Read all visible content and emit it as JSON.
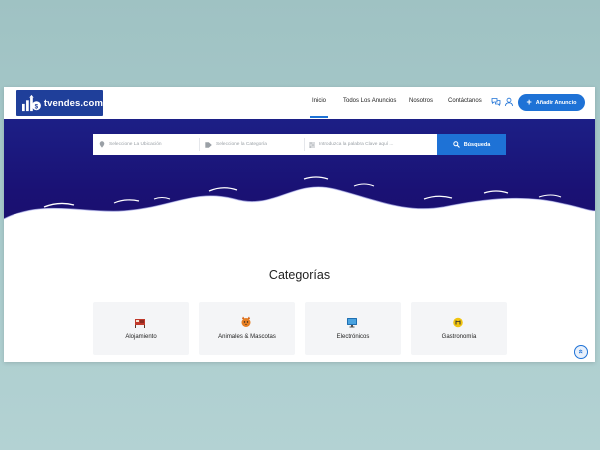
{
  "header": {
    "logo_text": "tvendes.com",
    "nav": [
      {
        "label": "Inicio",
        "active": true
      },
      {
        "label": "Todos Los Anuncios",
        "active": false
      },
      {
        "label": "Nosotros",
        "active": false
      },
      {
        "label": "Contáctanos",
        "active": false
      }
    ],
    "icons": [
      "chat-icon",
      "user-icon"
    ],
    "cta_label": "Añadir Anuncio"
  },
  "search": {
    "location_placeholder": "Seleccione La Ubicación",
    "category_placeholder": "Seleccione la Categoría",
    "keyword_placeholder": "Introduzca la palabra Clave aquí ...",
    "button_label": "Búsqueda"
  },
  "categories": {
    "title": "Categorías",
    "items": [
      {
        "label": "Alojamiento",
        "icon": "lodging-icon"
      },
      {
        "label": "Animales & Mascotas",
        "icon": "pets-icon"
      },
      {
        "label": "Electrónicos",
        "icon": "monitor-icon"
      },
      {
        "label": "Gastronomía",
        "icon": "food-icon"
      }
    ]
  },
  "colors": {
    "brand_blue": "#1e72d6",
    "hero_navy": "#1a1174",
    "logo_bg": "#1f3f9a"
  }
}
